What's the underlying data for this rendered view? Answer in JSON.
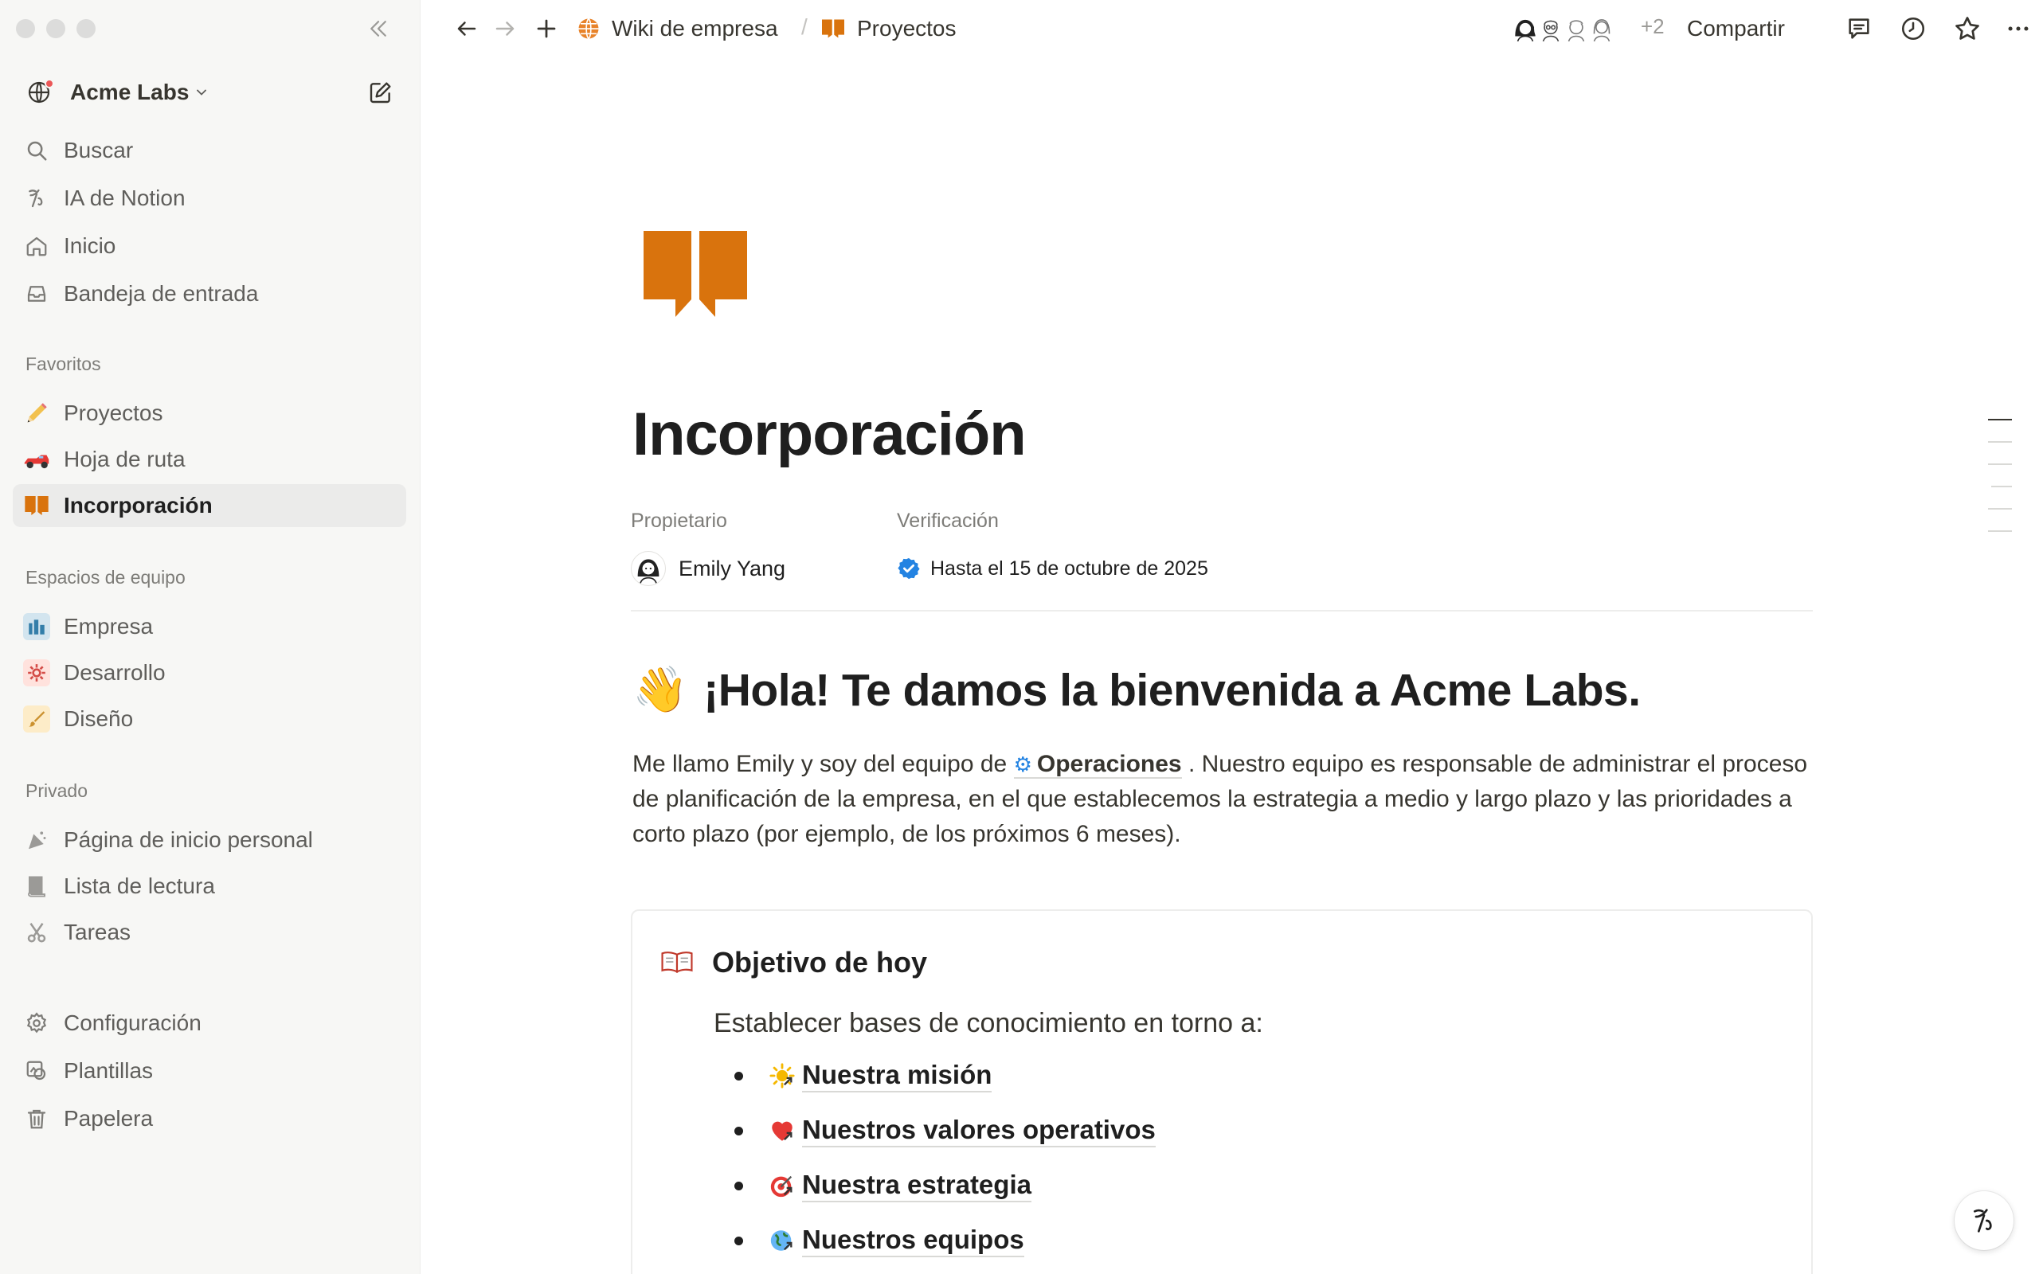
{
  "sidebar": {
    "workspace_name": "Acme Labs",
    "nav": [
      {
        "label": "Buscar",
        "icon": "search-icon"
      },
      {
        "label": "IA de Notion",
        "icon": "notion-ai-icon"
      },
      {
        "label": "Inicio",
        "icon": "home-icon"
      },
      {
        "label": "Bandeja de entrada",
        "icon": "inbox-icon"
      }
    ],
    "favorites_label": "Favoritos",
    "favorites": [
      {
        "label": "Proyectos",
        "icon": "pencil-icon"
      },
      {
        "label": "Hoja de ruta",
        "icon": "race-car-icon"
      },
      {
        "label": "Incorporación",
        "icon": "book-icon",
        "active": true
      }
    ],
    "teamspaces_label": "Espacios de equipo",
    "teamspaces": [
      {
        "label": "Empresa",
        "icon": "city-icon"
      },
      {
        "label": "Desarrollo",
        "icon": "gear-icon"
      },
      {
        "label": "Diseño",
        "icon": "paintbrush-icon"
      }
    ],
    "private_label": "Privado",
    "private": [
      {
        "label": "Página de inicio personal",
        "icon": "party-icon"
      },
      {
        "label": "Lista de lectura",
        "icon": "book-stack-icon"
      },
      {
        "label": "Tareas",
        "icon": "scissors-icon"
      }
    ],
    "bottom": [
      {
        "label": "Configuración",
        "icon": "settings-icon"
      },
      {
        "label": "Plantillas",
        "icon": "templates-icon"
      },
      {
        "label": "Papelera",
        "icon": "trash-icon"
      }
    ]
  },
  "topbar": {
    "breadcrumb": [
      {
        "label": "Wiki de empresa",
        "icon": "globe-icon"
      },
      {
        "label": "Proyectos",
        "icon": "book-icon"
      }
    ],
    "separator": "/",
    "extra_collaborators": "+2",
    "share_label": "Compartir"
  },
  "page": {
    "title": "Incorporación",
    "properties": {
      "owner_label": "Propietario",
      "owner_value": "Emily Yang",
      "verification_label": "Verificación",
      "verification_value": "Hasta el 15 de octubre de 2025"
    },
    "heading": "¡Hola! Te damos la bienvenida a Acme Labs.",
    "heading_emoji": "👋",
    "intro_before": "Me llamo Emily y soy del equipo de ",
    "intro_mention": "Operaciones",
    "intro_after": " . Nuestro equipo es responsable de administrar el proceso de planificación de la empresa, en el que establecemos la estrategia a medio y largo plazo y las prioridades a corto plazo (por ejemplo, de los próximos 6 meses).",
    "callout": {
      "title": "Objetivo de hoy",
      "text": "Establecer bases de conocimiento en torno a:",
      "items": [
        {
          "label": "Nuestra misión",
          "icon": "sunrise-icon"
        },
        {
          "label": "Nuestros valores operativos",
          "icon": "heart-icon"
        },
        {
          "label": "Nuestra estrategia",
          "icon": "target-icon"
        },
        {
          "label": "Nuestros equipos",
          "icon": "globe-icon"
        }
      ]
    }
  },
  "colors": {
    "accent_orange": "#d9730d",
    "sidebar_bg": "#f7f7f5",
    "verified_blue": "#2383e2",
    "text": "#37352f"
  }
}
